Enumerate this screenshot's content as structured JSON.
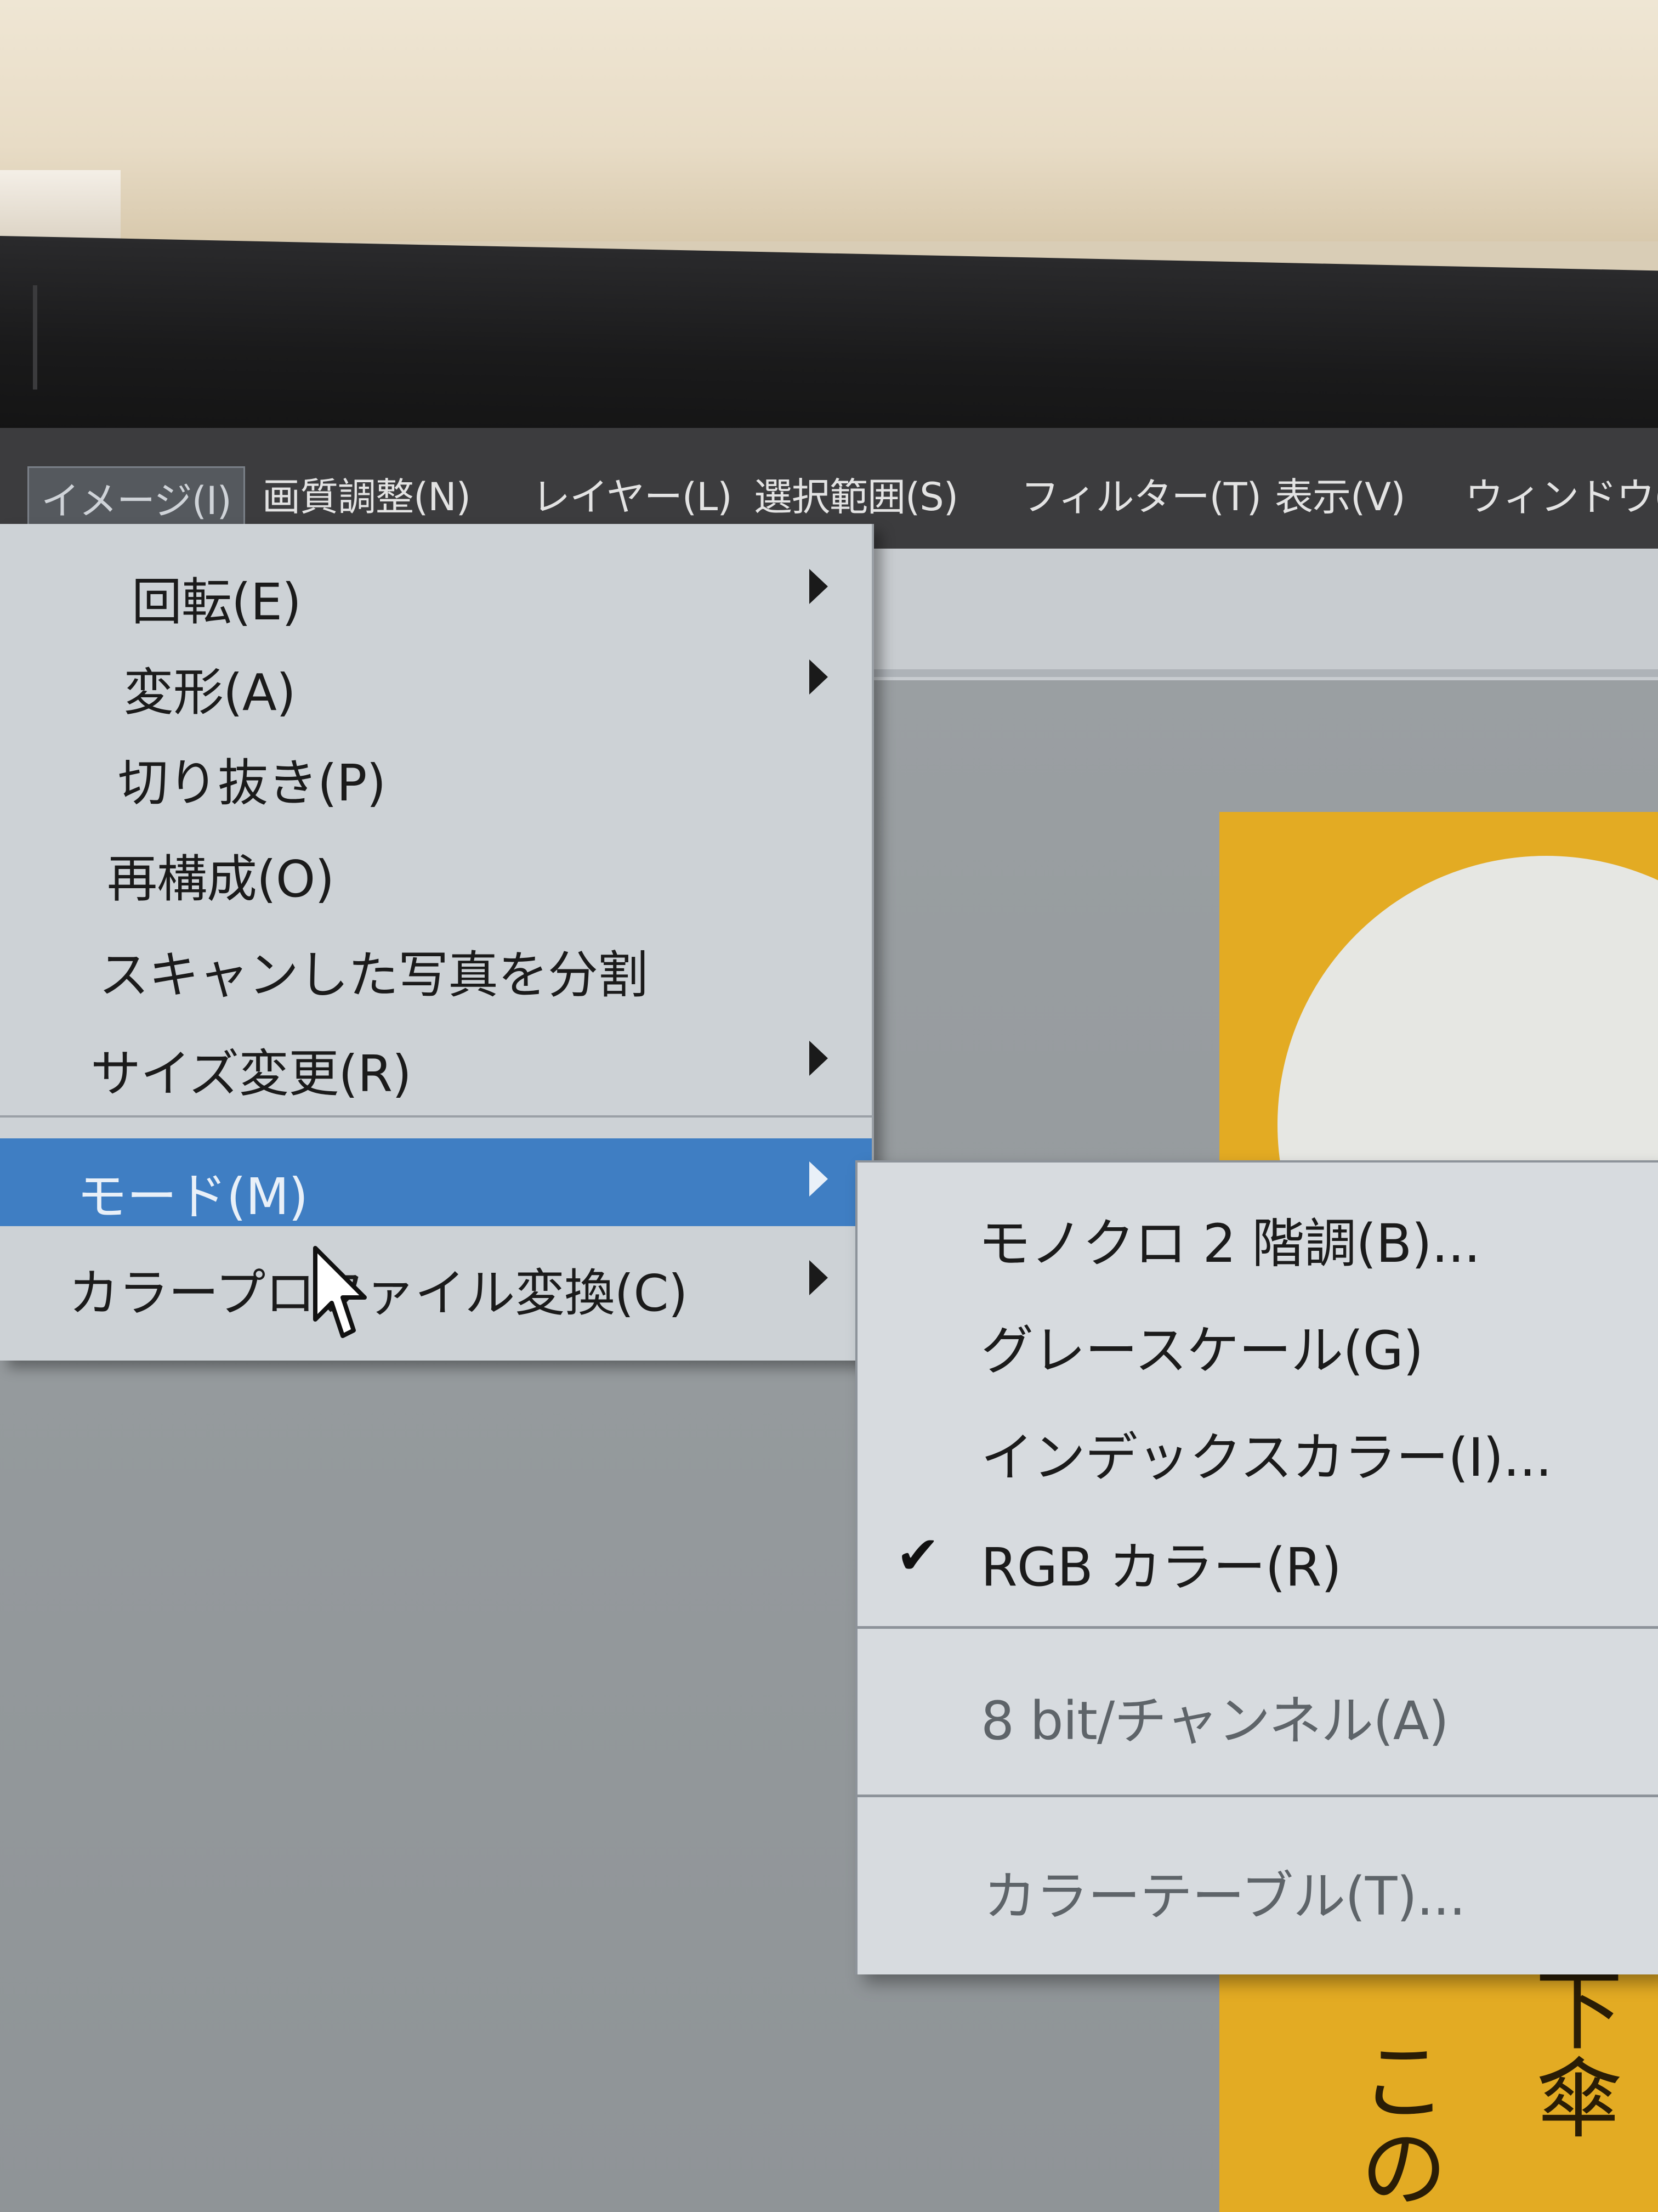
{
  "menubar": {
    "items": [
      {
        "label": "イメージ(I)",
        "active": true
      },
      {
        "label": "画質調整(N)"
      },
      {
        "label": "レイヤー(L)"
      },
      {
        "label": "選択範囲(S)"
      },
      {
        "label": "フィルター(T)"
      },
      {
        "label": "表示(V)"
      },
      {
        "label": "ウィンドウ(W"
      }
    ]
  },
  "dropdown": {
    "items": [
      {
        "label": "回転(E)",
        "has_submenu": true
      },
      {
        "label": "変形(A)",
        "has_submenu": true
      },
      {
        "label": "切り抜き(P)",
        "has_submenu": false
      },
      {
        "label": "再構成(O)",
        "has_submenu": false
      },
      {
        "label": "スキャンした写真を分割",
        "has_submenu": false
      },
      {
        "label": "サイズ変更(R)",
        "has_submenu": true
      },
      {
        "label": "モード(M)",
        "has_submenu": true,
        "highlighted": true
      },
      {
        "label": "カラープロファイル変換(C)",
        "has_submenu": true
      }
    ]
  },
  "submenu": {
    "items": [
      {
        "label": "モノクロ 2 階調(B)..."
      },
      {
        "label": "グレースケール(G)"
      },
      {
        "label": "インデックスカラー(I)..."
      },
      {
        "label": "RGB カラー(R)",
        "checked": true,
        "check_glyph": "✔"
      },
      {
        "label": "8 bit/チャンネル(A)",
        "disabled": true
      },
      {
        "label": "カラーテーブル(T)...",
        "disabled": true
      }
    ]
  },
  "document": {
    "text_col1": "下傘",
    "text_col2": "この"
  },
  "colors": {
    "menubar_bg": "#3c3c3e",
    "menu_bg": "#cdd2d6",
    "highlight": "#3f7ec3",
    "document_bg": "#e3ab23"
  }
}
